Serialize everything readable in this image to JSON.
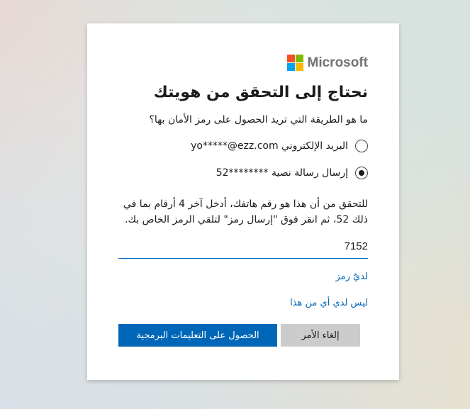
{
  "brand": {
    "name": "Microsoft",
    "logo_colors": [
      "#f25022",
      "#7fba00",
      "#00a4ef",
      "#ffb900"
    ]
  },
  "page": {
    "title": "نحتاج إلى التحقق من هويتك",
    "subtitle": "ما هو الطريقة التي تريد الحصول على رمز الأمان بها؟"
  },
  "options": [
    {
      "label": "البريد الإلكتروني yo*****@ezz.com",
      "selected": false
    },
    {
      "label": "إرسال رسالة نصية ********52",
      "selected": true
    }
  ],
  "description": "للتحقق من أن هذا هو رقم هاتفك، أدخل آخر 4 أرقام بما في ذلك 52، ثم انقر فوق \"إرسال رمز\" لتلقي الرمز الخاص بك.",
  "phone_input": {
    "value": "7152"
  },
  "links": {
    "have_code": "لديّ رمز",
    "have_none": "ليس لدي أي من هذا"
  },
  "buttons": {
    "cancel": "إلغاء الأمر",
    "get_code": "الحصول على التعليمات البرمجية"
  },
  "colors": {
    "accent": "#0067b8",
    "cancel_bg": "#cccccc"
  }
}
